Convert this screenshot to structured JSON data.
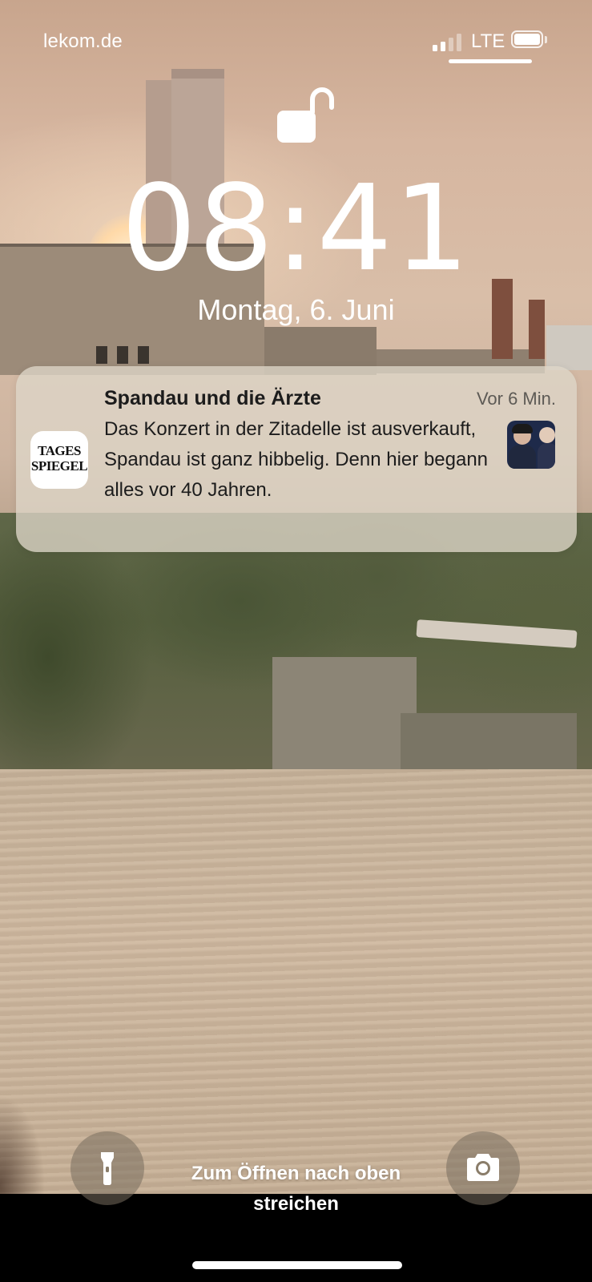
{
  "status_bar": {
    "carrier": "lekom.de",
    "network": "LTE",
    "signal_bars_active": 2,
    "signal_bars_total": 4
  },
  "lock_screen": {
    "lock_state": "unlocked",
    "time": "08:41",
    "date": "Montag, 6. Juni"
  },
  "notification": {
    "app_icon_text": "TAGES SPIEGEL",
    "title": "Spandau und die Ärzte",
    "time": "Vor 6 Min.",
    "body": "Das Konzert in der Zitadelle ist ausverkauft, Spandau ist ganz hibbelig. Denn hier begann alles vor 40 Jahren."
  },
  "bottom": {
    "flashlight_icon": "flashlight-icon",
    "camera_icon": "camera-icon",
    "swipe_hint": "Zum Öffnen nach oben streichen"
  },
  "colors": {
    "notification_bg": "#ded6c8",
    "text_primary": "#1c1c1c",
    "text_secondary": "#5d5a55",
    "foreground": "#ffffff"
  }
}
